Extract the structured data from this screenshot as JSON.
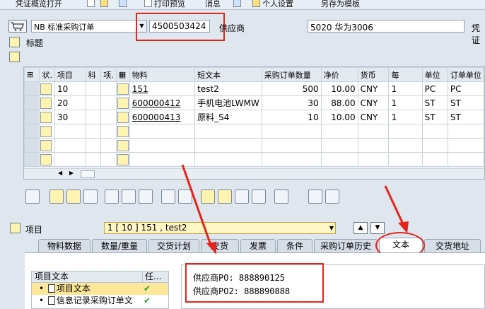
{
  "toolbar": {
    "voucher_overview": "凭证概览打开",
    "print_preview": "打印预览",
    "message": "消息",
    "personal_settings": "个人设置",
    "save_as_template": "另存为模板"
  },
  "header": {
    "doc_type": "NB 标准采购订单",
    "po_number": "4500503424",
    "vendor_label": "供应商",
    "vendor_value": "5020 华为3006",
    "voucher_label": "凭证",
    "title_label": "标题"
  },
  "grid": {
    "columns": [
      "状.",
      "项目",
      "科",
      "项.",
      "物料",
      "短文本",
      "采购订单数量",
      "净价",
      "货币",
      "每",
      "单位",
      "订单单位"
    ],
    "rows": [
      {
        "item": "10",
        "material": "151",
        "text": "test2",
        "qty": "500",
        "price": "10.00",
        "currency": "CNY",
        "per": "1",
        "unit": "PC",
        "order_unit": "PC"
      },
      {
        "item": "20",
        "material": "600000412",
        "text": "手机电池LWMW",
        "qty": "30",
        "price": "88.00",
        "currency": "CNY",
        "per": "1",
        "unit": "ST",
        "order_unit": "ST"
      },
      {
        "item": "30",
        "material": "600000413",
        "text": "原料_S4",
        "qty": "10",
        "price": "10.00",
        "currency": "CNY",
        "per": "1",
        "unit": "ST",
        "order_unit": "ST"
      }
    ]
  },
  "item_section": {
    "label": "项目",
    "selected": "1 [ 10 ] 151 , test2"
  },
  "tabs": [
    "物料数据",
    "数量/重量",
    "交货计划",
    "交货",
    "发票",
    "条件",
    "采购订单历史",
    "文本",
    "交货地址"
  ],
  "active_tab": "文本",
  "text_tree": {
    "header": "项目文本",
    "header_col2": "任...",
    "items": [
      "项目文本",
      "信息记录采购订单文"
    ]
  },
  "text_content": {
    "line1": "供应商PO: 888890125",
    "line2": "供应商PO2: 888890888"
  },
  "colors": {
    "highlight": "#e4241b",
    "accent_yellow": "#fff3b0",
    "background": "#dfe6ee"
  }
}
